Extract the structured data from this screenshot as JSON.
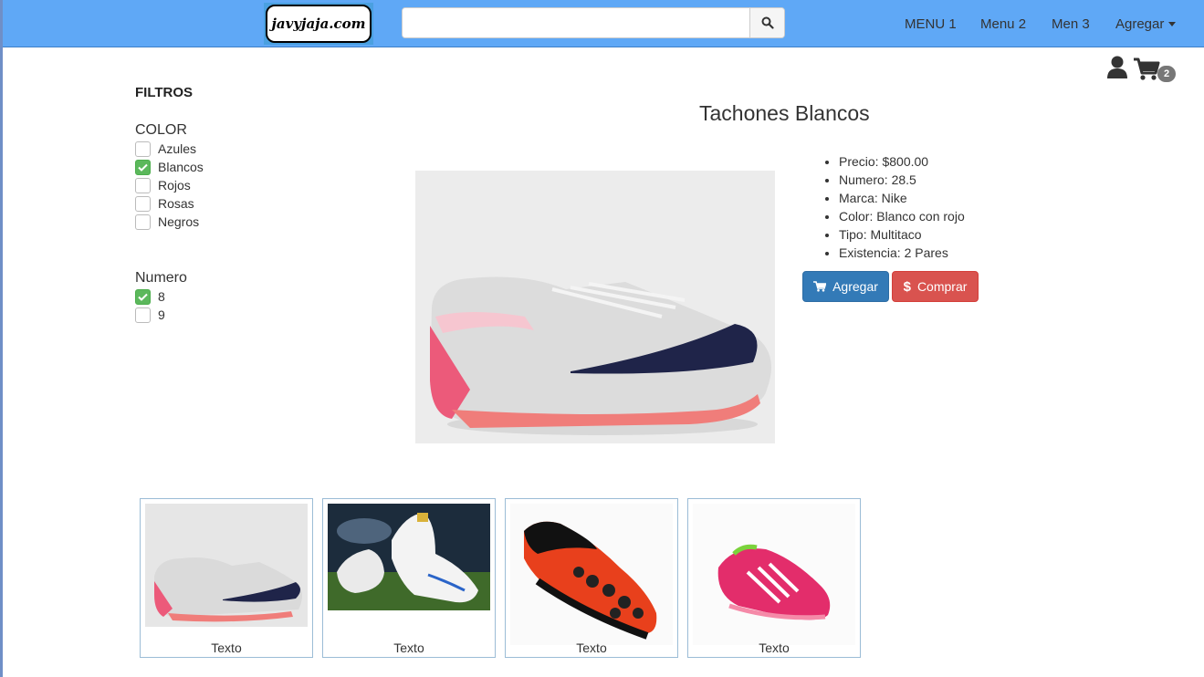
{
  "navbar": {
    "logo_text": "javyjaja.com",
    "search": {
      "value": "",
      "placeholder": ""
    },
    "menu": [
      "MENU 1",
      "Menu 2",
      "Men 3"
    ],
    "dropdown_label": "Agregar"
  },
  "header_actions": {
    "cart_count": "2"
  },
  "filters": {
    "title": "FILTROS",
    "color": {
      "title": "COLOR",
      "options": [
        {
          "label": "Azules",
          "checked": false
        },
        {
          "label": "Blancos",
          "checked": true
        },
        {
          "label": "Rojos",
          "checked": false
        },
        {
          "label": "Rosas",
          "checked": false
        },
        {
          "label": "Negros",
          "checked": false
        }
      ]
    },
    "numero": {
      "title": "Numero",
      "options": [
        {
          "label": "8",
          "checked": true
        },
        {
          "label": "9",
          "checked": false
        }
      ]
    }
  },
  "product": {
    "title": "Tachones Blancos",
    "details": [
      "Precio: $800.00",
      "Numero: 28.5",
      "Marca: Nike",
      "Color: Blanco con rojo",
      "Tipo: Multitaco",
      "Existencia: 2 Pares"
    ],
    "add_label": "Agregar",
    "buy_label": "Comprar"
  },
  "thumbnails": [
    {
      "caption": "Texto"
    },
    {
      "caption": "Texto"
    },
    {
      "caption": "Texto"
    },
    {
      "caption": "Texto"
    }
  ],
  "colors": {
    "navbar": "#5fa8f6",
    "primary": "#337ab7",
    "danger": "#d9534f",
    "checked": "#5cb85c",
    "badge": "#777777"
  }
}
